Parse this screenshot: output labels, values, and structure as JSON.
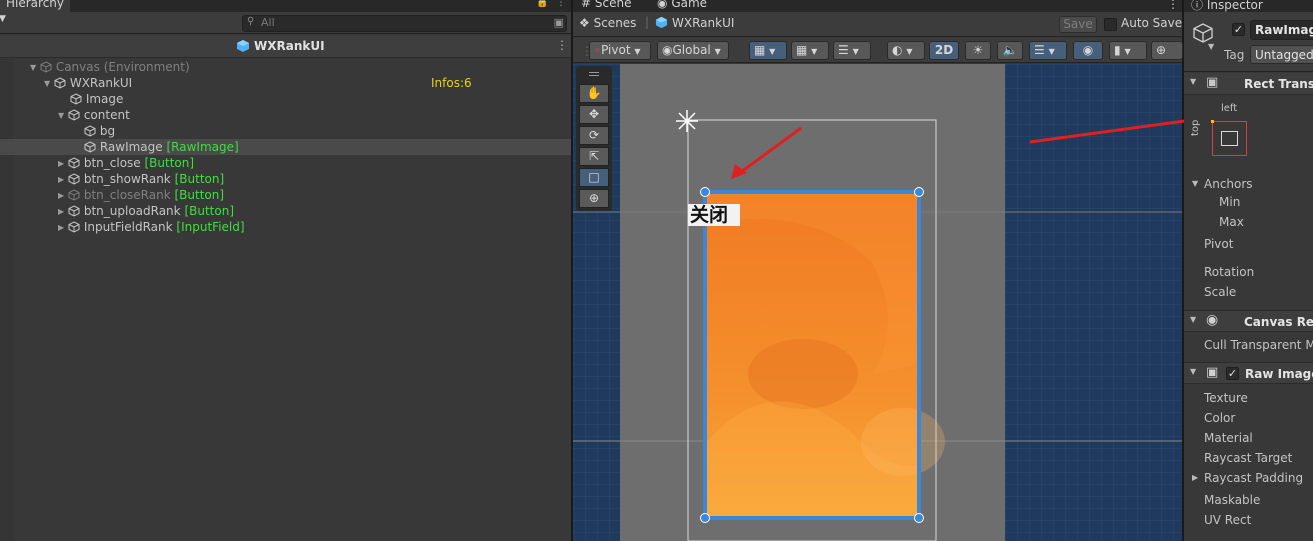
{
  "hierarchy": {
    "tab_label": "Hierarchy",
    "add_label": "+",
    "search_placeholder": "All",
    "scene_name": "WXRankUI",
    "items": [
      {
        "label": "Canvas (Environment)",
        "tag": ""
      },
      {
        "label": "WXRankUI",
        "tag": ""
      },
      {
        "label": "Image",
        "tag": ""
      },
      {
        "label": "content",
        "tag": ""
      },
      {
        "label": "bg",
        "tag": ""
      },
      {
        "label": "RawImage",
        "tag": "[RawImage]"
      },
      {
        "label": "btn_close",
        "tag": "[Button]"
      },
      {
        "label": "btn_showRank",
        "tag": "[Button]"
      },
      {
        "label": "btn_closeRank",
        "tag": "[Button]"
      },
      {
        "label": "btn_uploadRank",
        "tag": "[Button]"
      },
      {
        "label": "InputFieldRank",
        "tag": "[InputField]"
      }
    ],
    "infos_label": "Infos:6"
  },
  "scene": {
    "tabs": [
      "Scene",
      "Game"
    ],
    "breadcrumb_root": "Scenes",
    "breadcrumb_prefab": "WXRankUI",
    "save_label": "Save",
    "auto_save_label": "Auto Save",
    "pivot_label": "Pivot",
    "global_label": "Global",
    "mode_2d_label": "2D",
    "button_text": "关闭"
  },
  "inspector": {
    "tab_label": "Inspector",
    "object_name": "RawImage",
    "tag_label": "Tag",
    "tag_value": "Untagged",
    "rect_transform_label": "Rect Transf",
    "anchor_preset_left": "left",
    "anchor_preset_top": "top",
    "anchors_label": "Anchors",
    "min_label": "Min",
    "max_label": "Max",
    "pivot_label": "Pivot",
    "rotation_label": "Rotation",
    "scale_label": "Scale",
    "canvas_renderer_label": "Canvas Ren",
    "cull_label": "Cull Transparent Me",
    "raw_image_label": "Raw Image",
    "raw_image_fields": [
      "Texture",
      "Color",
      "Material",
      "Raycast Target",
      "Raycast Padding",
      "Maskable",
      "UV Rect"
    ]
  },
  "colors": {
    "accent_blue": "#3d87d8",
    "annotation_red": "#e02020",
    "component_tag_green": "#3ee03e",
    "infos_yellow": "#e8d21a",
    "orange_top": "#f07a22",
    "orange_bottom": "#f8a838"
  }
}
